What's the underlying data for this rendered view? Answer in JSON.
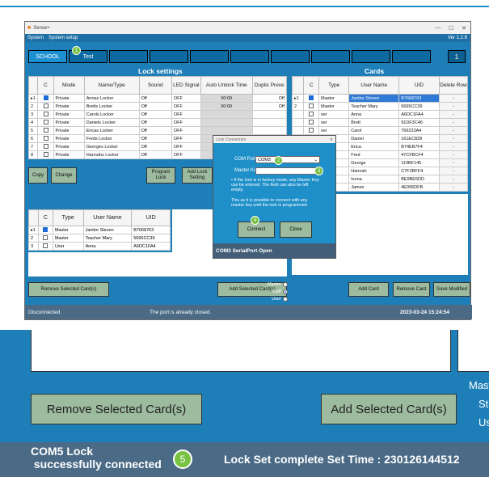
{
  "window": {
    "title": "Sense+",
    "version": "Ver 1.2.6",
    "controls": [
      "—",
      "☐",
      "✕"
    ]
  },
  "menu": {
    "items": [
      "System",
      "System setup"
    ]
  },
  "tabs": {
    "items": [
      "SCHOOL",
      "Test",
      "",
      "",
      "",
      "",
      "",
      "",
      "",
      "",
      ""
    ],
    "counter": "1"
  },
  "lock_settings": {
    "title": "Lock settings",
    "headers": [
      "",
      "C",
      "Mode",
      "Name/Type",
      "Sound",
      "LED Signal",
      "Auto Unlock Time",
      "Duplic Preve"
    ],
    "rows": [
      {
        "idx": "▸1",
        "checked": true,
        "mode": "Private",
        "name": "Annas Locker",
        "sound": "Off",
        "led": "OFF",
        "time": "00:00",
        "dup": "Off"
      },
      {
        "idx": "2",
        "checked": false,
        "mode": "Private",
        "name": "Bretts Locker",
        "sound": "Off",
        "led": "OFF",
        "time": "00:00",
        "dup": "Off"
      },
      {
        "idx": "3",
        "checked": false,
        "mode": "Private",
        "name": "Carols Locker",
        "sound": "Off",
        "led": "OFF",
        "time": "",
        "dup": ""
      },
      {
        "idx": "4",
        "checked": false,
        "mode": "Private",
        "name": "Daniels Locker",
        "sound": "Off",
        "led": "OFF",
        "time": "",
        "dup": ""
      },
      {
        "idx": "5",
        "checked": false,
        "mode": "Private",
        "name": "Ericas Locker",
        "sound": "Off",
        "led": "OFF",
        "time": "",
        "dup": ""
      },
      {
        "idx": "6",
        "checked": false,
        "mode": "Private",
        "name": "Freds Locker",
        "sound": "Off",
        "led": "OFF",
        "time": "",
        "dup": ""
      },
      {
        "idx": "7",
        "checked": false,
        "mode": "Private",
        "name": "Georges Locker",
        "sound": "Off",
        "led": "OFF",
        "time": "",
        "dup": ""
      },
      {
        "idx": "8",
        "checked": false,
        "mode": "Private",
        "name": "Hannahs Locker",
        "sound": "Off",
        "led": "OFF",
        "time": "",
        "dup": ""
      }
    ]
  },
  "lock_buttons": {
    "copy": "Copy",
    "change": "Change",
    "program": "Program Lock",
    "add_setting": "Add Lock Setting"
  },
  "lock_users": {
    "headers": [
      "",
      "C",
      "Type",
      "User Name",
      "UID"
    ],
    "rows": [
      {
        "idx": "▸1",
        "checked": true,
        "type": "Master",
        "name": "Janitor Steven",
        "uid": "B7668763"
      },
      {
        "idx": "2",
        "checked": false,
        "type": "Master",
        "name": "Teacher Mary",
        "uid": "5665CC39"
      },
      {
        "idx": "3",
        "checked": false,
        "type": "User",
        "name": "Anna",
        "uid": "A6DC1FA4"
      }
    ]
  },
  "cards": {
    "title": "Cards",
    "headers": [
      "",
      "C",
      "Type",
      "User Name",
      "UID",
      "Delete Row"
    ],
    "rows": [
      {
        "idx": "▸1",
        "checked": true,
        "type": "Master",
        "name": "Janitor Steven",
        "uid": "B7668763",
        "del": "-"
      },
      {
        "idx": "2",
        "checked": false,
        "type": "Master",
        "name": "Teacher Mary",
        "uid": "5665CC39",
        "del": "-"
      },
      {
        "idx": "",
        "checked": false,
        "type": "ser",
        "name": "Anna",
        "uid": "A6DC1FA4",
        "del": "-"
      },
      {
        "idx": "",
        "checked": false,
        "type": "ser",
        "name": "Brett",
        "uid": "91DF3C46",
        "del": "-"
      },
      {
        "idx": "",
        "checked": false,
        "type": "ser",
        "name": "Carol",
        "uid": "766223A4",
        "del": "-"
      },
      {
        "idx": "",
        "checked": false,
        "type": "ser",
        "name": "Daniel",
        "uid": "161EC839",
        "del": "-"
      },
      {
        "idx": "",
        "checked": false,
        "type": "ser",
        "name": "Erica",
        "uid": "B74EB7F4",
        "del": "-"
      },
      {
        "idx": "",
        "checked": false,
        "type": "ser",
        "name": "Fred",
        "uid": "47CFBCF4",
        "del": "-"
      },
      {
        "idx": "",
        "checked": false,
        "type": "ser",
        "name": "George",
        "uid": "119BF145",
        "del": "-"
      },
      {
        "idx": "",
        "checked": false,
        "type": "ser",
        "name": "Hannah",
        "uid": "C7F2BFF4",
        "del": "-"
      },
      {
        "idx": "",
        "checked": false,
        "type": "ser",
        "name": "Ivona",
        "uid": "BE9BE5DD",
        "del": "-"
      },
      {
        "idx": "",
        "checked": false,
        "type": "ser",
        "name": "James",
        "uid": "4E095DFB",
        "del": "-"
      }
    ]
  },
  "bottom_buttons": {
    "remove": "Remove Selected Card(s)",
    "add_selected": "Add Selected Card(s)",
    "add_card": "Add Card",
    "remove_card": "Remove Card",
    "save": "Save Modified"
  },
  "radio": {
    "master": "Master",
    "staff": "Staff",
    "user": "User",
    "selected": "Staff"
  },
  "status": {
    "left": "Disconnected",
    "middle": "The port is already closed.",
    "right": "2023-03-24 15:24:54"
  },
  "dialog": {
    "title": "Lock Connection",
    "com_label": "COM Port",
    "com_value": "COM3",
    "key_label": "Master Key",
    "key_value": "",
    "note1": "• If the lock is in factory mode, any Master Key can be entered. The field can also be left empty.",
    "note2": "This as it is possible to connect with any master key until the lock is programmed.",
    "connect": "Connect",
    "close": "Close",
    "footer": "COM3 SerialPort Open"
  },
  "badges": [
    "1",
    "2",
    "3",
    "4",
    "5"
  ],
  "zoom": {
    "remove": "Remove Selected Card(s)",
    "add_selected": "Add Selected Card(s)",
    "side": [
      "Mast",
      "St",
      "Us"
    ],
    "status_left": "COM5 Lock\n successfully connected",
    "status_right": "Lock Set complete Set Time : 230126144512"
  }
}
